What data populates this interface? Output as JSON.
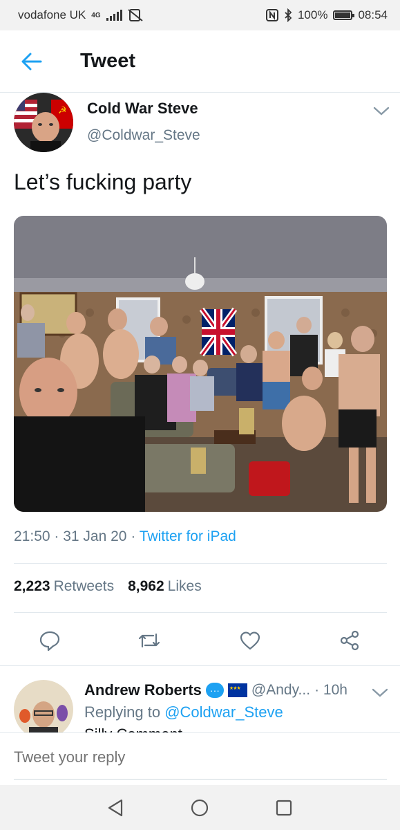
{
  "status_bar": {
    "carrier": "vodafone UK",
    "network": "4G",
    "battery": "100%",
    "time": "08:54",
    "icons": [
      "signal-icon",
      "no-sim-card-icon",
      "nfc-icon",
      "bluetooth-icon",
      "battery-icon"
    ]
  },
  "header": {
    "title": "Tweet",
    "back_icon": "arrow-left-icon"
  },
  "tweet": {
    "author_name": "Cold War Steve",
    "author_handle": "@Coldwar_Steve",
    "text": "Let’s fucking party",
    "image": "party-collage-image",
    "time": "21:50",
    "date": "31 Jan 20",
    "source": "Twitter for iPad",
    "retweets_count": "2,223",
    "retweets_label": "Retweets",
    "likes_count": "8,962",
    "likes_label": "Likes"
  },
  "actions": [
    "reply-icon",
    "retweet-icon",
    "like-icon",
    "share-icon"
  ],
  "reply": {
    "name": "Andrew Roberts",
    "handle": "@Andy...",
    "time": "· 10h",
    "replying_to_label": "Replying to",
    "replying_to_handle": "@Coldwar_Steve",
    "text_preview": "Silly Comment"
  },
  "compose": {
    "placeholder": "Tweet your reply"
  },
  "colors": {
    "accent": "#1da1f2",
    "secondary_text": "#657786",
    "primary_text": "#14171a"
  }
}
